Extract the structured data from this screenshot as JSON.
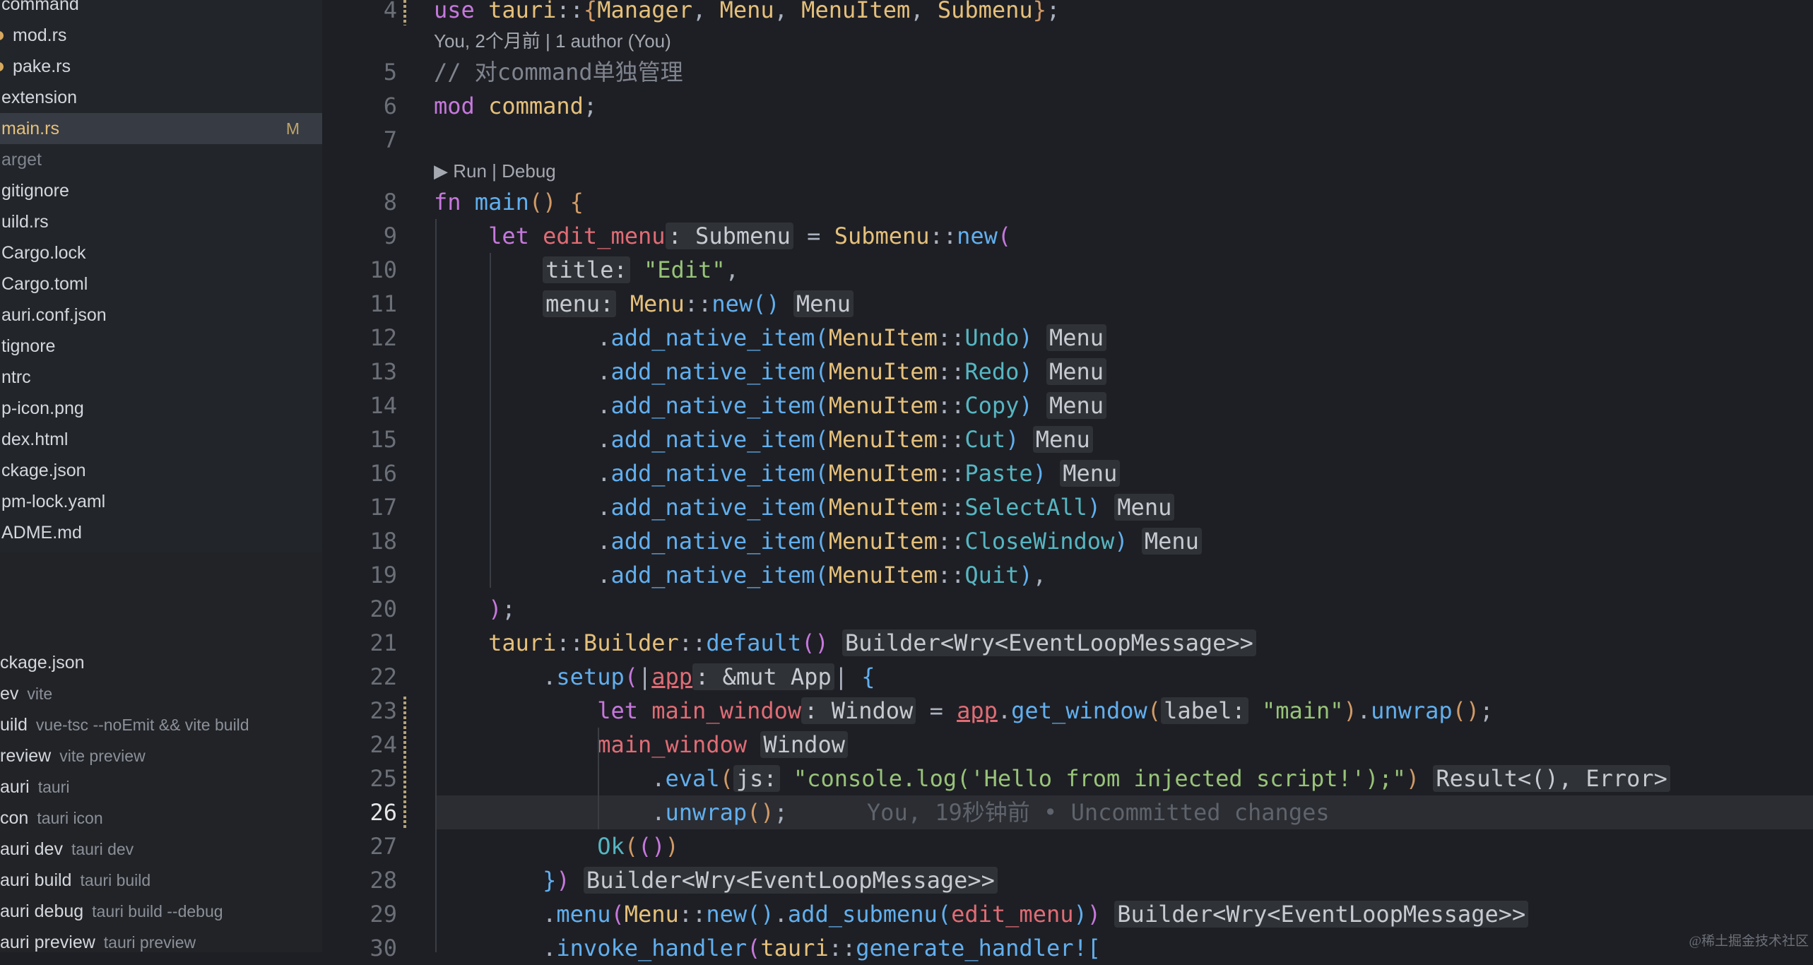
{
  "sidebar": {
    "tree": [
      {
        "label": "command",
        "dot": false,
        "dim": false
      },
      {
        "label": "mod.rs",
        "dot": true,
        "dim": false
      },
      {
        "label": "pake.rs",
        "dot": true,
        "dim": false
      },
      {
        "label": "extension",
        "dot": false,
        "dim": false
      },
      {
        "label": "main.rs",
        "dot": false,
        "selected": true,
        "badge": "M"
      },
      {
        "label": "arget",
        "dot": false,
        "dim": true
      },
      {
        "label": "gitignore",
        "dot": false,
        "dim": false
      },
      {
        "label": "uild.rs",
        "dot": false,
        "dim": false
      },
      {
        "label": "Cargo.lock",
        "dot": false,
        "dim": false
      },
      {
        "label": "Cargo.toml",
        "dot": false,
        "dim": false
      },
      {
        "label": "auri.conf.json",
        "dot": false,
        "dim": false
      },
      {
        "label": "tignore",
        "dot": false,
        "dim": false
      },
      {
        "label": "ntrc",
        "dot": false,
        "dim": false
      },
      {
        "label": "p-icon.png",
        "dot": false,
        "dim": false
      },
      {
        "label": "dex.html",
        "dot": false,
        "dim": false
      },
      {
        "label": "ckage.json",
        "dot": false,
        "dim": false
      },
      {
        "label": "pm-lock.yaml",
        "dot": false,
        "dim": false
      },
      {
        "label": "ADME.md",
        "dot": false,
        "dim": false
      }
    ],
    "scripts_file": "ckage.json",
    "scripts": [
      {
        "name": "ev",
        "cmd": "vite"
      },
      {
        "name": "uild",
        "cmd": "vue-tsc --noEmit && vite build"
      },
      {
        "name": "review",
        "cmd": "vite preview"
      },
      {
        "name": "auri",
        "cmd": "tauri"
      },
      {
        "name": "con",
        "cmd": "tauri icon"
      },
      {
        "name": "auri dev",
        "cmd": "tauri dev"
      },
      {
        "name": "auri build",
        "cmd": "tauri build"
      },
      {
        "name": "auri debug",
        "cmd": "tauri build --debug"
      },
      {
        "name": "auri preview",
        "cmd": "tauri preview"
      }
    ]
  },
  "editor": {
    "active_line": "26",
    "blame_header": "You, 2个月前 | 1 author (You)",
    "run_debug_lens": "▶ Run | Debug",
    "inline_blame": "You, 19秒钟前 • Uncommitted changes",
    "lines": [
      {
        "n": "4",
        "tokens": [
          [
            "k",
            "use "
          ],
          [
            "t",
            "tauri"
          ],
          [
            "p",
            "::"
          ],
          [
            "b1",
            "{"
          ],
          [
            "t",
            "Manager"
          ],
          [
            "p",
            ", "
          ],
          [
            "t",
            "Menu"
          ],
          [
            "p",
            ", "
          ],
          [
            "t",
            "MenuItem"
          ],
          [
            "p",
            ", "
          ],
          [
            "t",
            "Submenu"
          ],
          [
            "b1",
            "}"
          ],
          [
            "p",
            ";"
          ]
        ]
      },
      {
        "n": "5",
        "tokens": [
          [
            "c",
            "// 对command单独管理"
          ]
        ]
      },
      {
        "n": "6",
        "tokens": [
          [
            "k",
            "mod "
          ],
          [
            "t",
            "command"
          ],
          [
            "p",
            ";"
          ]
        ]
      },
      {
        "n": "7",
        "tokens": []
      },
      {
        "n": "8",
        "tokens": [
          [
            "k",
            "fn "
          ],
          [
            "f",
            "main"
          ],
          [
            "b1",
            "() {"
          ]
        ]
      },
      {
        "n": "9",
        "tokens": [
          [
            "k",
            "    let "
          ],
          [
            "v",
            "edit_menu"
          ],
          [
            "inlay",
            ": Submenu"
          ],
          [
            "p",
            " = "
          ],
          [
            "t",
            "Submenu"
          ],
          [
            "p",
            "::"
          ],
          [
            "f",
            "new"
          ],
          [
            "b2",
            "("
          ]
        ]
      },
      {
        "n": "10",
        "tokens": [
          [
            "p",
            "        "
          ],
          [
            "inlay",
            "title:"
          ],
          [
            "p",
            " "
          ],
          [
            "s",
            "\"Edit\""
          ],
          [
            "p",
            ","
          ]
        ]
      },
      {
        "n": "11",
        "tokens": [
          [
            "p",
            "        "
          ],
          [
            "inlay",
            "menu:"
          ],
          [
            "p",
            " "
          ],
          [
            "t",
            "Menu"
          ],
          [
            "p",
            "::"
          ],
          [
            "f",
            "new"
          ],
          [
            "b3",
            "()"
          ],
          [
            "p",
            " "
          ],
          [
            "inlay",
            "Menu"
          ]
        ]
      },
      {
        "n": "12",
        "tokens": [
          [
            "p",
            "            ."
          ],
          [
            "f",
            "add_native_item"
          ],
          [
            "b3",
            "("
          ],
          [
            "t",
            "MenuItem"
          ],
          [
            "p",
            "::"
          ],
          [
            "ct",
            "Undo"
          ],
          [
            "b3",
            ")"
          ],
          [
            "p",
            " "
          ],
          [
            "inlay",
            "Menu"
          ]
        ]
      },
      {
        "n": "13",
        "tokens": [
          [
            "p",
            "            ."
          ],
          [
            "f",
            "add_native_item"
          ],
          [
            "b3",
            "("
          ],
          [
            "t",
            "MenuItem"
          ],
          [
            "p",
            "::"
          ],
          [
            "ct",
            "Redo"
          ],
          [
            "b3",
            ")"
          ],
          [
            "p",
            " "
          ],
          [
            "inlay",
            "Menu"
          ]
        ]
      },
      {
        "n": "14",
        "tokens": [
          [
            "p",
            "            ."
          ],
          [
            "f",
            "add_native_item"
          ],
          [
            "b3",
            "("
          ],
          [
            "t",
            "MenuItem"
          ],
          [
            "p",
            "::"
          ],
          [
            "ct",
            "Copy"
          ],
          [
            "b3",
            ")"
          ],
          [
            "p",
            " "
          ],
          [
            "inlay",
            "Menu"
          ]
        ]
      },
      {
        "n": "15",
        "tokens": [
          [
            "p",
            "            ."
          ],
          [
            "f",
            "add_native_item"
          ],
          [
            "b3",
            "("
          ],
          [
            "t",
            "MenuItem"
          ],
          [
            "p",
            "::"
          ],
          [
            "ct",
            "Cut"
          ],
          [
            "b3",
            ")"
          ],
          [
            "p",
            " "
          ],
          [
            "inlay",
            "Menu"
          ]
        ]
      },
      {
        "n": "16",
        "tokens": [
          [
            "p",
            "            ."
          ],
          [
            "f",
            "add_native_item"
          ],
          [
            "b3",
            "("
          ],
          [
            "t",
            "MenuItem"
          ],
          [
            "p",
            "::"
          ],
          [
            "ct",
            "Paste"
          ],
          [
            "b3",
            ")"
          ],
          [
            "p",
            " "
          ],
          [
            "inlay",
            "Menu"
          ]
        ]
      },
      {
        "n": "17",
        "tokens": [
          [
            "p",
            "            ."
          ],
          [
            "f",
            "add_native_item"
          ],
          [
            "b3",
            "("
          ],
          [
            "t",
            "MenuItem"
          ],
          [
            "p",
            "::"
          ],
          [
            "ct",
            "SelectAll"
          ],
          [
            "b3",
            ")"
          ],
          [
            "p",
            " "
          ],
          [
            "inlay",
            "Menu"
          ]
        ]
      },
      {
        "n": "18",
        "tokens": [
          [
            "p",
            "            ."
          ],
          [
            "f",
            "add_native_item"
          ],
          [
            "b3",
            "("
          ],
          [
            "t",
            "MenuItem"
          ],
          [
            "p",
            "::"
          ],
          [
            "ct",
            "CloseWindow"
          ],
          [
            "b3",
            ")"
          ],
          [
            "p",
            " "
          ],
          [
            "inlay",
            "Menu"
          ]
        ]
      },
      {
        "n": "19",
        "tokens": [
          [
            "p",
            "            ."
          ],
          [
            "f",
            "add_native_item"
          ],
          [
            "b3",
            "("
          ],
          [
            "t",
            "MenuItem"
          ],
          [
            "p",
            "::"
          ],
          [
            "ct",
            "Quit"
          ],
          [
            "b3",
            ")"
          ],
          [
            "p",
            ","
          ]
        ]
      },
      {
        "n": "20",
        "tokens": [
          [
            "b2",
            "    )"
          ],
          [
            "p",
            ";"
          ]
        ]
      },
      {
        "n": "21",
        "tokens": [
          [
            "t",
            "    tauri"
          ],
          [
            "p",
            "::"
          ],
          [
            "t",
            "Builder"
          ],
          [
            "p",
            "::"
          ],
          [
            "f",
            "default"
          ],
          [
            "b2",
            "()"
          ],
          [
            "p",
            " "
          ],
          [
            "inlay",
            "Builder<Wry<EventLoopMessage>>"
          ]
        ]
      },
      {
        "n": "22",
        "tokens": [
          [
            "p",
            "        ."
          ],
          [
            "f",
            "setup"
          ],
          [
            "b2",
            "("
          ],
          [
            "p",
            "|"
          ],
          [
            "v",
            "app"
          ],
          [
            "inlay",
            ": &mut App"
          ],
          [
            "p",
            "| "
          ],
          [
            "b3",
            "{"
          ]
        ]
      },
      {
        "n": "23",
        "tokens": [
          [
            "k",
            "            let "
          ],
          [
            "v",
            "main_window"
          ],
          [
            "inlay",
            ": Window"
          ],
          [
            "p",
            " = "
          ],
          [
            "v",
            "app"
          ],
          [
            "p",
            "."
          ],
          [
            "f",
            "get_window"
          ],
          [
            "b1",
            "("
          ],
          [
            "inlay",
            "label:"
          ],
          [
            "p",
            " "
          ],
          [
            "s",
            "\"main\""
          ],
          [
            "b1",
            ")"
          ],
          [
            "p",
            "."
          ],
          [
            "f",
            "unwrap"
          ],
          [
            "b1",
            "()"
          ],
          [
            "p",
            ";"
          ]
        ]
      },
      {
        "n": "24",
        "tokens": [
          [
            "v",
            "            main_window"
          ],
          [
            "p",
            " "
          ],
          [
            "inlay",
            "Window"
          ]
        ]
      },
      {
        "n": "25",
        "tokens": [
          [
            "p",
            "                ."
          ],
          [
            "f",
            "eval"
          ],
          [
            "b1",
            "("
          ],
          [
            "inlay",
            "js:"
          ],
          [
            "p",
            " "
          ],
          [
            "s",
            "\"console.log('Hello from injected script!');\""
          ],
          [
            "b1",
            ")"
          ],
          [
            "p",
            " "
          ],
          [
            "inlay",
            "Result<(), Error>"
          ]
        ]
      },
      {
        "n": "26",
        "tokens": [
          [
            "p",
            "                ."
          ],
          [
            "f",
            "unwrap"
          ],
          [
            "b1",
            "()"
          ],
          [
            "p",
            ";"
          ]
        ]
      },
      {
        "n": "27",
        "tokens": [
          [
            "ct",
            "            Ok"
          ],
          [
            "b1",
            "("
          ],
          [
            "b2",
            "()"
          ],
          [
            "b1",
            ")"
          ]
        ]
      },
      {
        "n": "28",
        "tokens": [
          [
            "b3",
            "        }"
          ],
          [
            "b2",
            ")"
          ],
          [
            "p",
            " "
          ],
          [
            "inlay",
            "Builder<Wry<EventLoopMessage>>"
          ]
        ]
      },
      {
        "n": "29",
        "tokens": [
          [
            "p",
            "        ."
          ],
          [
            "f",
            "menu"
          ],
          [
            "b2",
            "("
          ],
          [
            "t",
            "Menu"
          ],
          [
            "p",
            "::"
          ],
          [
            "f",
            "new"
          ],
          [
            "b3",
            "()"
          ],
          [
            "p",
            "."
          ],
          [
            "f",
            "add_submenu"
          ],
          [
            "b3",
            "("
          ],
          [
            "v",
            "edit_menu"
          ],
          [
            "b3",
            ")"
          ],
          [
            "b2",
            ")"
          ],
          [
            "p",
            " "
          ],
          [
            "inlay",
            "Builder<Wry<EventLoopMessage>>"
          ]
        ]
      },
      {
        "n": "30",
        "tokens": [
          [
            "p",
            "        ."
          ],
          [
            "f",
            "invoke_handler"
          ],
          [
            "b2",
            "("
          ],
          [
            "t",
            "tauri"
          ],
          [
            "p",
            "::"
          ],
          [
            "f",
            "generate_handler!"
          ],
          [
            "b3",
            "["
          ]
        ]
      }
    ]
  },
  "watermark": "@稀土掘金技术社区"
}
